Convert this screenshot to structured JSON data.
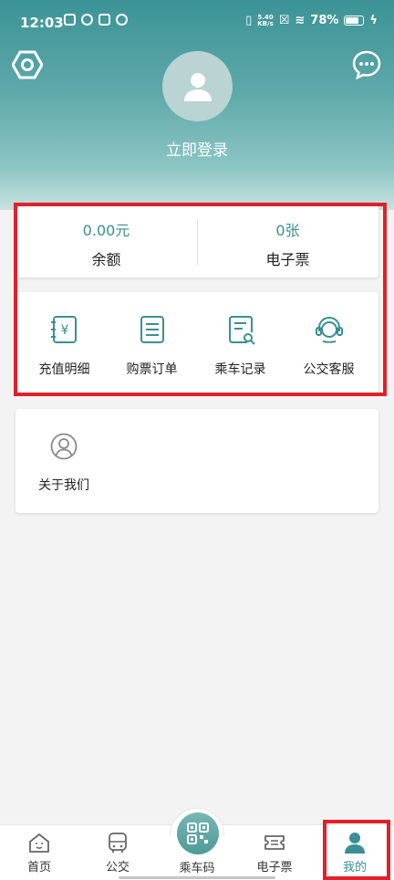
{
  "status_bar": {
    "time": "12:03",
    "net_speed_value": "5.40",
    "net_speed_unit": "KB/s",
    "battery": "78%"
  },
  "header": {
    "login_text": "立即登录"
  },
  "balance": {
    "amount": "0.00元",
    "amount_label": "余额",
    "tickets": "0张",
    "tickets_label": "电子票"
  },
  "functions": [
    {
      "label": "充值明细",
      "icon": "recharge-detail-icon"
    },
    {
      "label": "购票订单",
      "icon": "ticket-order-icon"
    },
    {
      "label": "乘车记录",
      "icon": "ride-record-icon"
    },
    {
      "label": "公交客服",
      "icon": "customer-service-icon"
    }
  ],
  "about": {
    "label": "关于我们",
    "icon": "user-circle-icon"
  },
  "tabbar": {
    "home": "首页",
    "bus": "公交",
    "qr": "乘车码",
    "eticket": "电子票",
    "mine": "我的"
  },
  "colors": {
    "accent": "#3a8f93",
    "highlight": "#e0202a"
  }
}
